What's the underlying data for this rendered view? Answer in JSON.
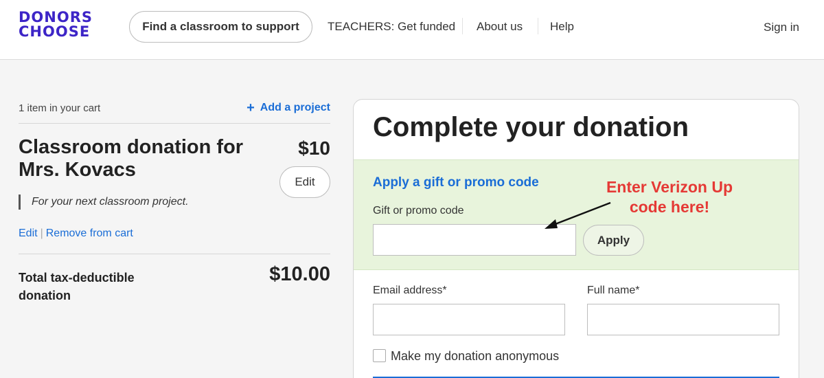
{
  "header": {
    "logo_line1": "DONORS",
    "logo_line2": "CHOOSE",
    "find_button": "Find a classroom to support",
    "nav": [
      "TEACHERS: Get funded",
      "About us",
      "Help"
    ],
    "sign_in": "Sign in"
  },
  "cart": {
    "count_text": "1 item in your cart",
    "add_project": "Add a project",
    "item_title": "Classroom donation for Mrs. Kovacs",
    "item_price": "$10",
    "edit_button": "Edit",
    "note": "For your next classroom project.",
    "edit_link": "Edit",
    "remove_link": "Remove from cart",
    "total_label": "Total tax-deductible donation",
    "total_value": "$10.00"
  },
  "donation": {
    "title": "Complete your donation",
    "promo_link": "Apply a gift or promo code",
    "promo_label": "Gift or promo code",
    "promo_value": "",
    "apply_button": "Apply",
    "annotation_line1": "Enter Verizon Up",
    "annotation_line2": "code here!",
    "annotation_color": "#e53935",
    "email_label": "Email address*",
    "email_value": "",
    "name_label": "Full name*",
    "name_value": "",
    "anonymous_label": "Make my donation anonymous",
    "anonymous_checked": false
  },
  "colors": {
    "brand": "#3d25c7",
    "link": "#1a6dd6",
    "promo_bg": "#e8f4dc"
  }
}
